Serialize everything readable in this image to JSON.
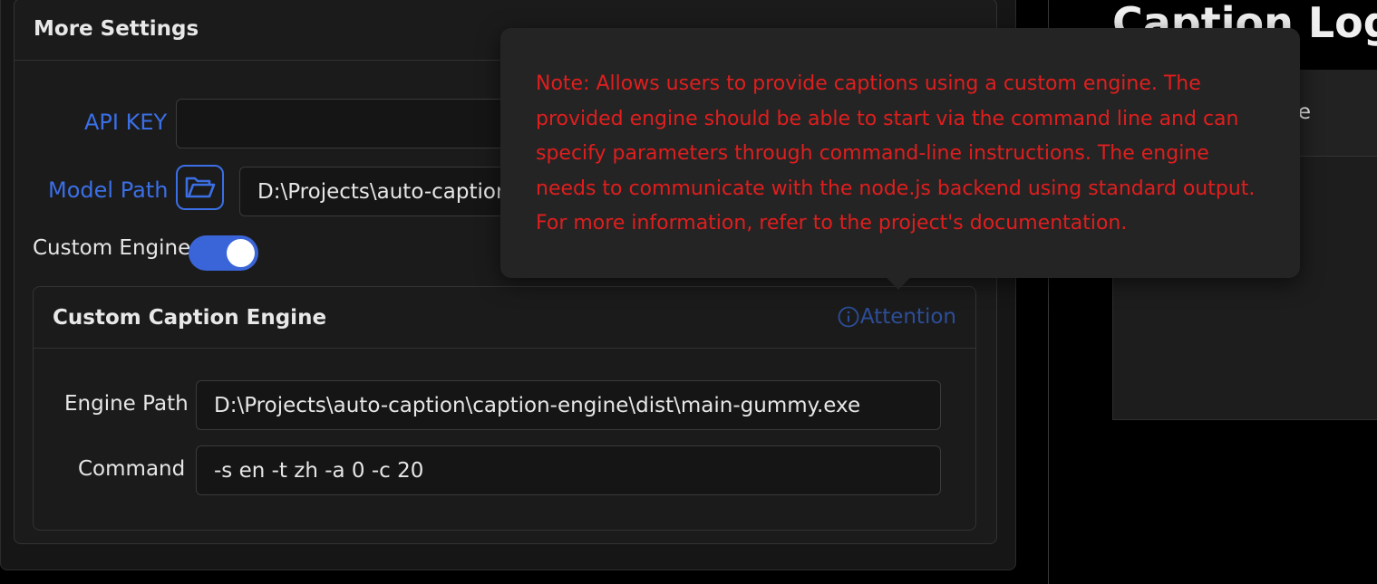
{
  "settings": {
    "title": "More Settings",
    "api_key": {
      "label": "API KEY",
      "value": ""
    },
    "model_path": {
      "label": "Model Path",
      "value": "D:\\Projects\\auto-caption\\"
    },
    "custom_engine": {
      "label": "Custom Engine",
      "enabled": true
    }
  },
  "engine_card": {
    "title": "Custom Caption Engine",
    "attention_label": "Attention",
    "engine_path": {
      "label": "Engine Path",
      "value": "D:\\Projects\\auto-caption\\caption-engine\\dist\\main-gummy.exe"
    },
    "command": {
      "label": "Command",
      "value": "-s en -t zh -a 0 -c 20"
    }
  },
  "tooltip": {
    "text": "Note: Allows users to provide captions using a custom engine. The provided engine should be able to start via the command line and can specify parameters through command-line instructions. The engine needs to communicate with the node.js backend using standard output. For more information, refer to the project's documentation."
  },
  "caption_log": {
    "title": "Caption Log",
    "header_partial_text": "e"
  },
  "colors": {
    "accent": "#3b6fe6",
    "tooltip_text": "#e01e1e",
    "attention": "#2c4e98"
  },
  "icons": {
    "folder": "folder-open-icon",
    "info": "info-circle-icon"
  }
}
